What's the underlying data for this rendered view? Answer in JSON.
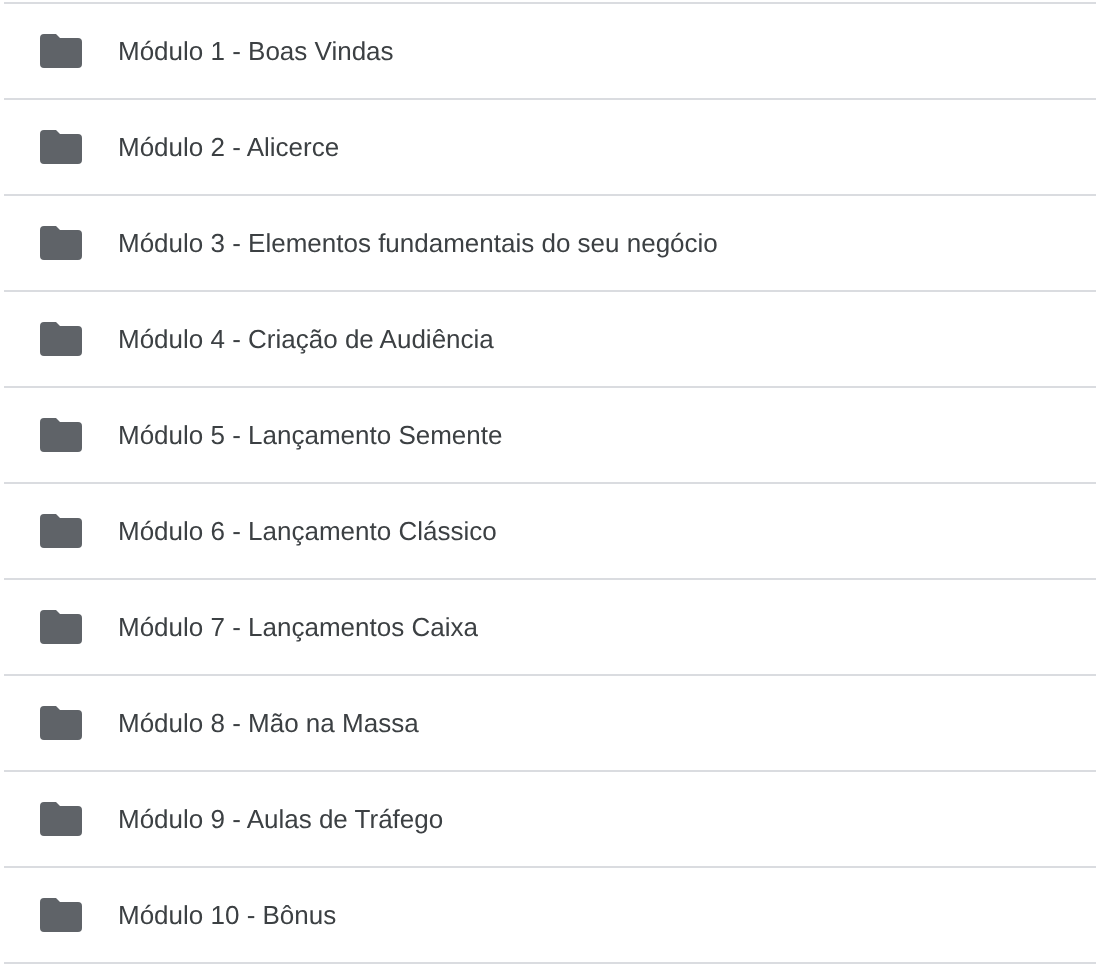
{
  "items": [
    {
      "label": "Módulo 1 - Boas Vindas"
    },
    {
      "label": "Módulo 2 - Alicerce"
    },
    {
      "label": "Módulo 3 - Elementos fundamentais do seu negócio"
    },
    {
      "label": "Módulo 4 - Criação de Audiência"
    },
    {
      "label": "Módulo 5 - Lançamento Semente"
    },
    {
      "label": "Módulo 6 - Lançamento Clássico"
    },
    {
      "label": "Módulo 7 - Lançamentos Caixa"
    },
    {
      "label": "Módulo 8 - Mão na Massa"
    },
    {
      "label": "Módulo 9 - Aulas de Tráfego"
    },
    {
      "label": "Módulo 10 - Bônus"
    }
  ]
}
